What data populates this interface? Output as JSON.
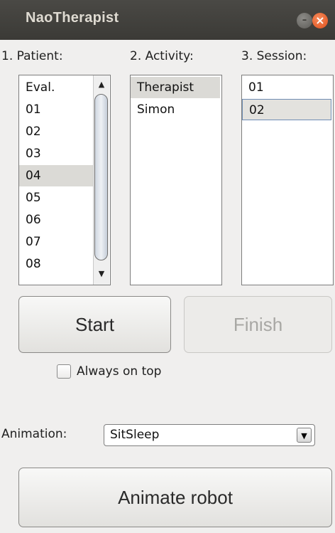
{
  "window": {
    "title": "NaoTherapist"
  },
  "patient": {
    "label": "1. Patient:",
    "items": [
      "Eval.",
      "01",
      "02",
      "03",
      "04",
      "05",
      "06",
      "07",
      "08"
    ],
    "selected": "04"
  },
  "activity": {
    "label": "2. Activity:",
    "items": [
      "Therapist",
      "Simon"
    ],
    "selected": "Therapist"
  },
  "session": {
    "label": "3. Session:",
    "items": [
      "01",
      "02"
    ],
    "selected": "02"
  },
  "buttons": {
    "start": "Start",
    "finish": "Finish",
    "animate": "Animate robot"
  },
  "always_on_top": {
    "label": "Always on top",
    "checked": false
  },
  "animation": {
    "label": "Animation:",
    "value": "SitSleep"
  },
  "icons": {
    "scroll_up": "▲",
    "scroll_down": "▼",
    "dropdown": "▼"
  }
}
